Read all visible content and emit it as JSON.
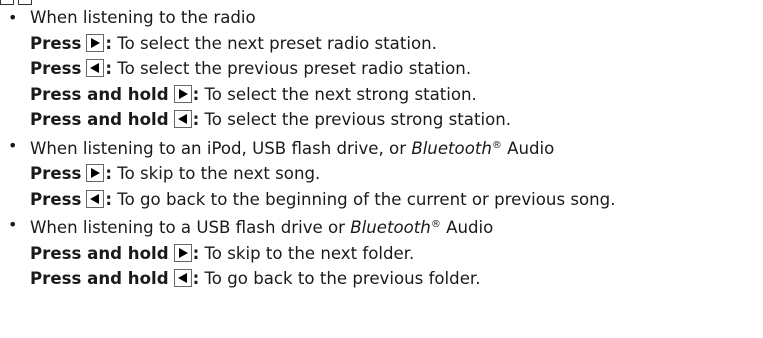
{
  "top_icons": [
    "box-icon",
    "box-icon"
  ],
  "sections": [
    {
      "bullet": {
        "pre": "When listening to the radio",
        "italic": "",
        "reg": "",
        "post": ""
      },
      "items": [
        {
          "label": "Press",
          "button": "right-arrow-icon",
          "desc": " To select the next preset radio station."
        },
        {
          "label": "Press",
          "button": "left-arrow-icon",
          "desc": " To select the previous preset radio station."
        },
        {
          "label": "Press and hold",
          "button": "right-arrow-icon",
          "desc": " To select the next strong station."
        },
        {
          "label": "Press and hold",
          "button": "left-arrow-icon",
          "desc": " To select the previous strong station."
        }
      ]
    },
    {
      "bullet": {
        "pre": "When listening to an iPod, USB flash drive, or ",
        "italic": "Bluetooth",
        "reg": "®",
        "post": " Audio"
      },
      "items": [
        {
          "label": "Press",
          "button": "right-arrow-icon",
          "desc": " To skip to the next song."
        },
        {
          "label": "Press",
          "button": "left-arrow-icon",
          "desc": " To go back to the beginning of the current or previous song."
        }
      ]
    },
    {
      "bullet": {
        "pre": "When listening to a USB flash drive or ",
        "italic": "Bluetooth",
        "reg": "®",
        "post": " Audio"
      },
      "items": [
        {
          "label": "Press and hold",
          "button": "right-arrow-icon",
          "desc": " To skip to the next folder."
        },
        {
          "label": "Press and hold",
          "button": "left-arrow-icon",
          "desc": " To go back to the previous folder."
        }
      ]
    }
  ],
  "colon": ":",
  "colors": {
    "text": "#1a1a1a",
    "icon_fill": "#000000",
    "button_border": "#666666"
  }
}
